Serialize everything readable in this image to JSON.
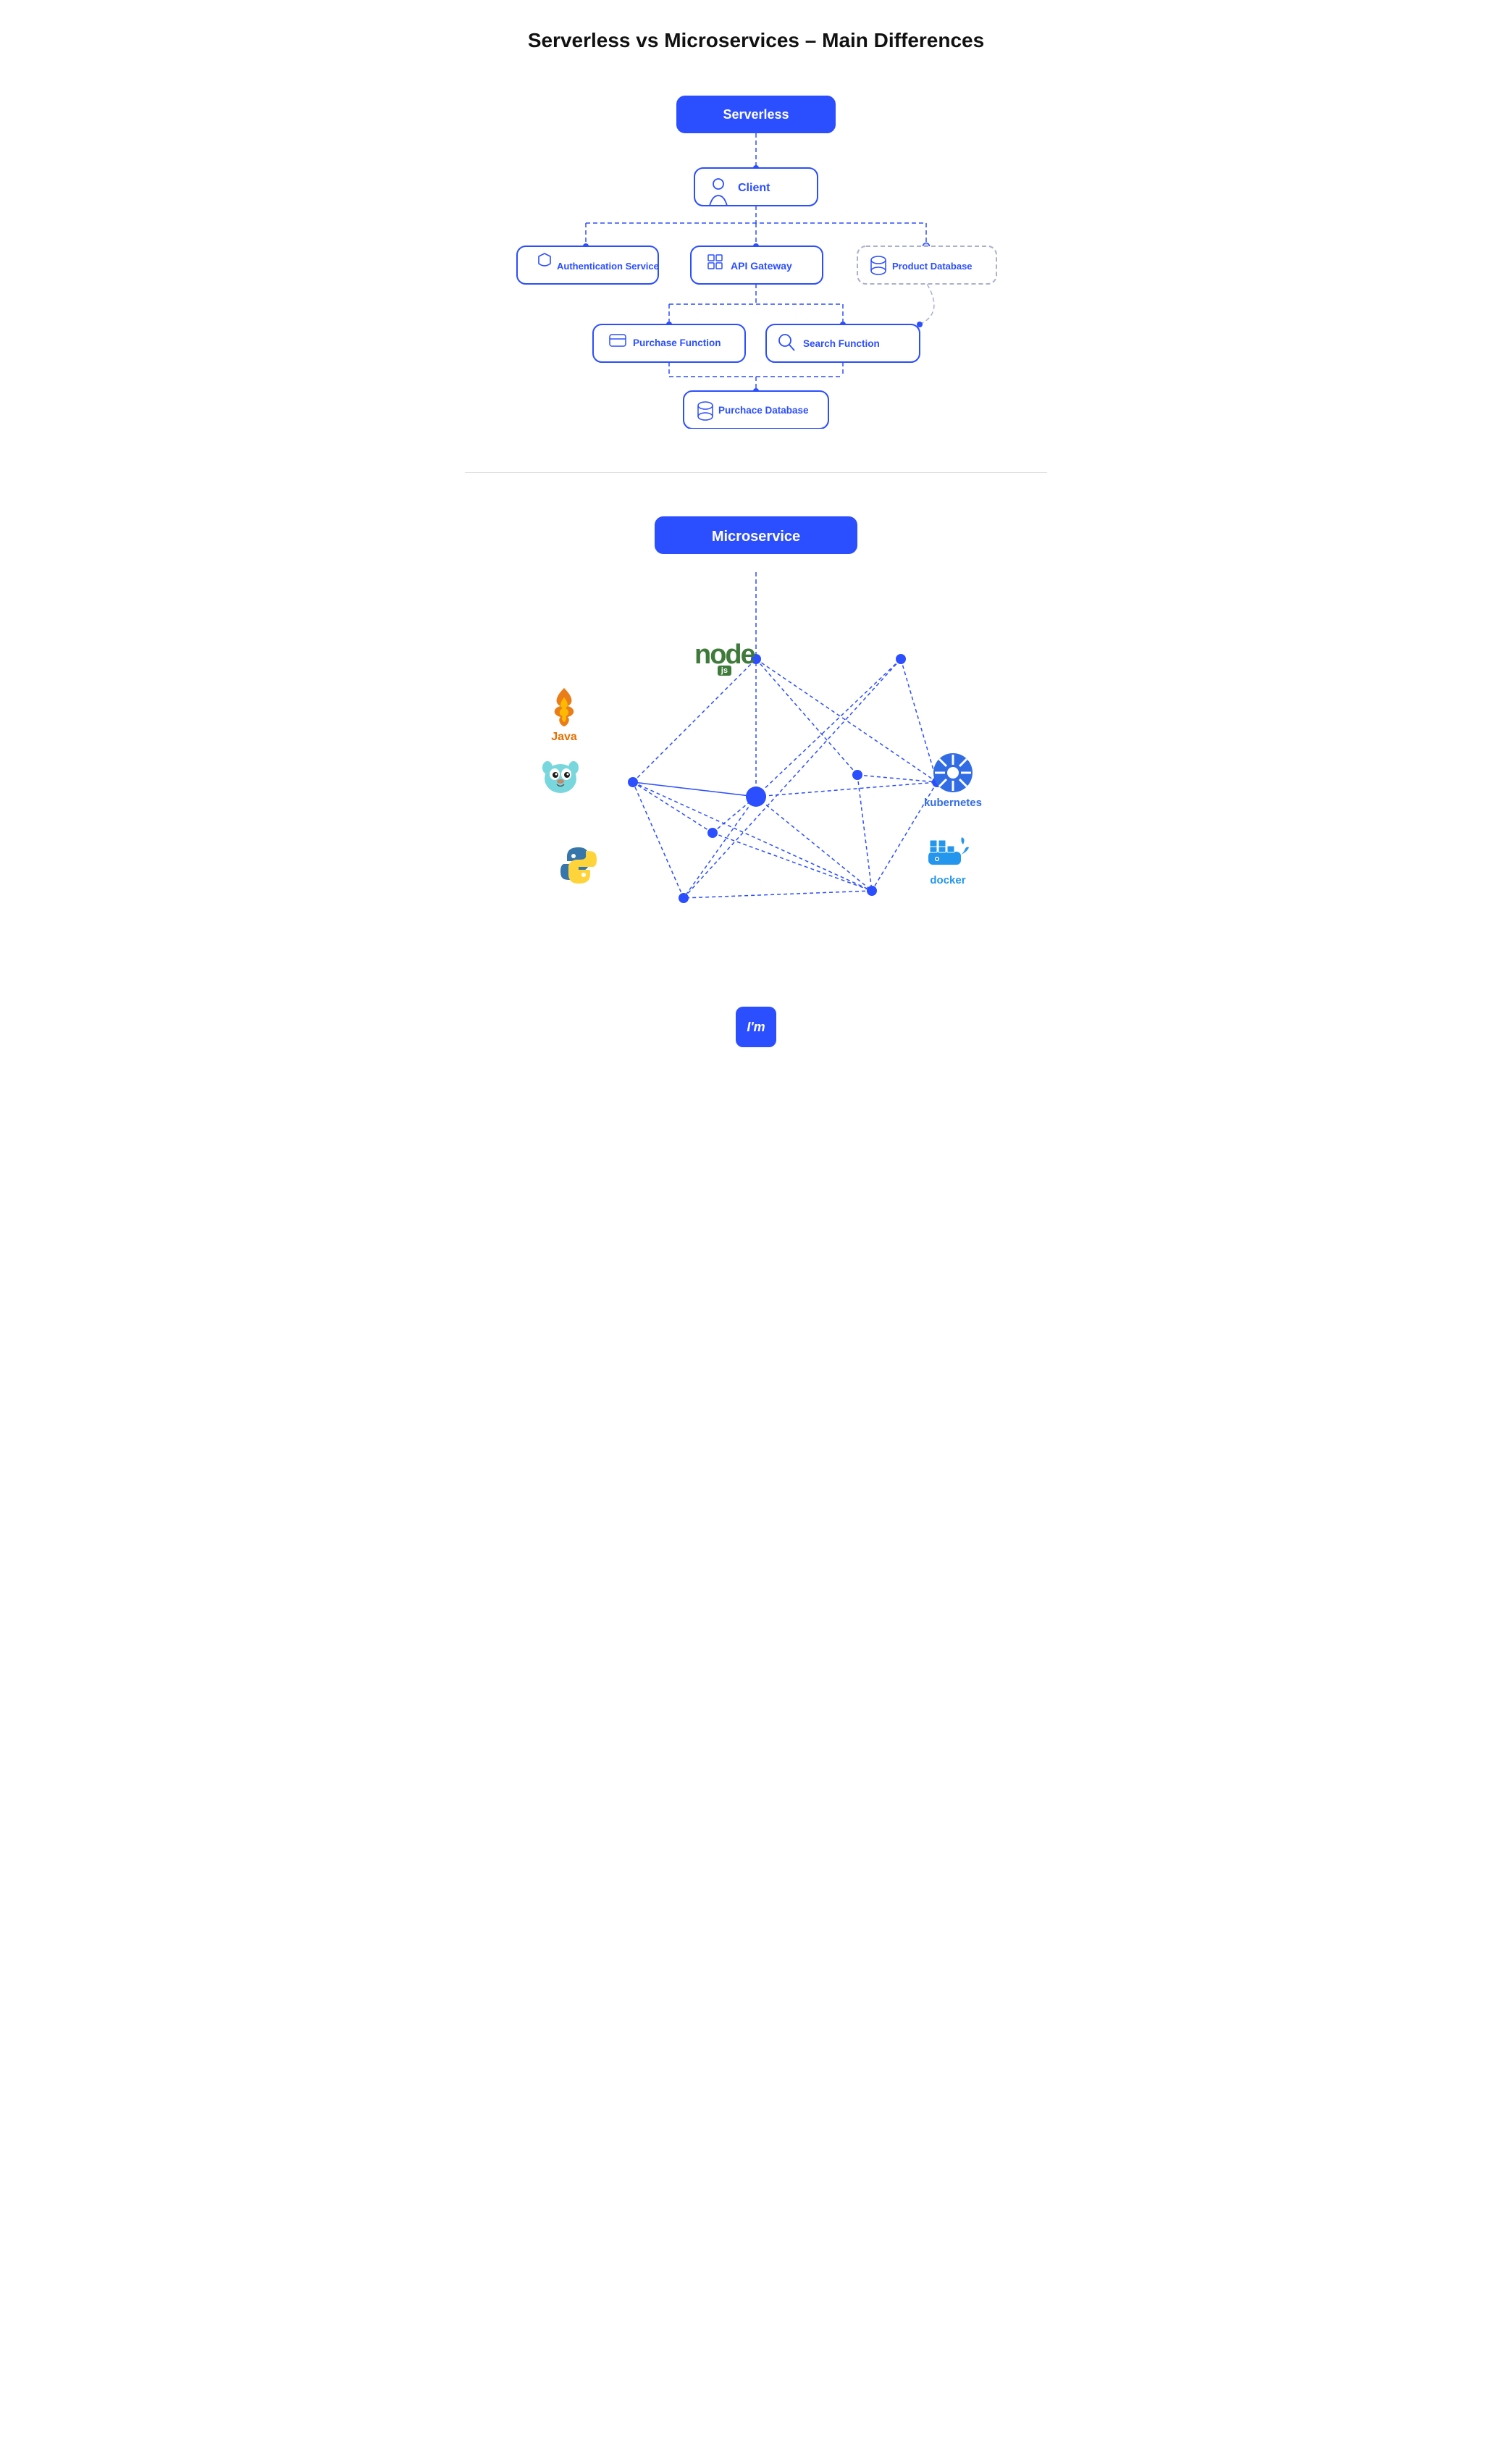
{
  "page": {
    "title": "Serverless vs Microservices – Main Differences"
  },
  "serverless": {
    "section_label": "Serverless",
    "nodes": {
      "serverless": "Serverless",
      "client": "Client",
      "auth": "Authentication Service",
      "api_gateway": "API Gateway",
      "product_db": "Product Database",
      "purchase_fn": "Purchase Function",
      "search_fn": "Search Function",
      "purchase_db": "Purchace Database"
    }
  },
  "microservice": {
    "section_label": "Microservice",
    "technologies": [
      {
        "name": "Java",
        "color": "#E76F00"
      },
      {
        "name": "node",
        "color": "#3E7A39"
      },
      {
        "name": "Go",
        "color": "#00ACD7"
      },
      {
        "name": "kubernetes",
        "color": "#326CE5"
      },
      {
        "name": "python",
        "color": "#3776AB"
      },
      {
        "name": "docker",
        "color": "#2496ED"
      }
    ]
  },
  "badge": {
    "label": "I'm"
  }
}
